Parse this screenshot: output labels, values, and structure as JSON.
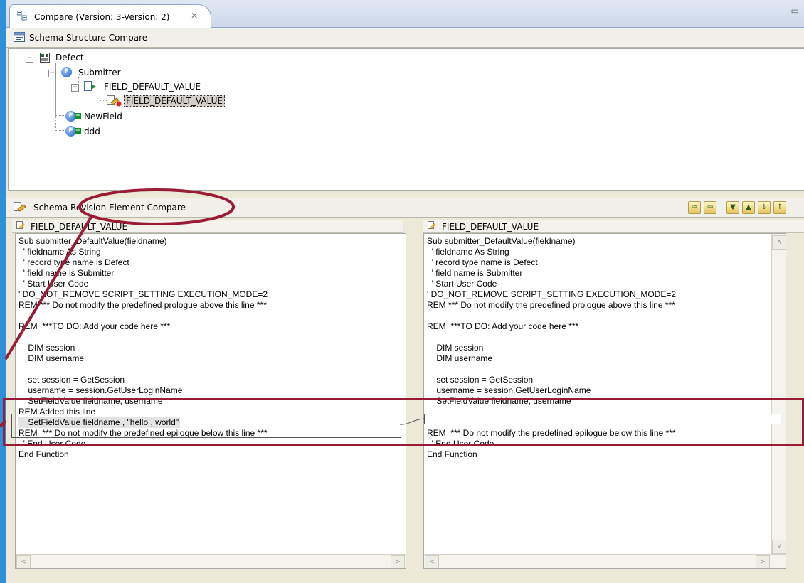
{
  "window": {
    "tab_title": "Compare (Version: 3-Version: 2)",
    "tab_close": "✕",
    "min_max": "▭"
  },
  "structure": {
    "header": "Schema Structure Compare",
    "nodes": {
      "defect": "Defect",
      "submitter": "Submitter",
      "field_default_value": "FIELD_DEFAULT_VALUE",
      "field_default_value_child": "FIELD_DEFAULT_VALUE",
      "newfield": "NewField",
      "ddd": "ddd"
    }
  },
  "revision": {
    "header": "Schema Revision Element Compare",
    "toolbar": [
      "copy-all-right",
      "copy-current-right",
      "next-diff",
      "prev-diff",
      "next-change",
      "prev-change"
    ]
  },
  "left_pane": {
    "title": "FIELD_DEFAULT_VALUE",
    "lines": [
      "Sub submitter_DefaultValue(fieldname)",
      "  ' fieldname As String",
      "  ' record type name is Defect",
      "  ' field name is Submitter",
      "  ' Start User Code",
      "' DO_NOT_REMOVE SCRIPT_SETTING EXECUTION_MODE=2",
      "REM *** Do not modify the predefined prologue above this line ***",
      "",
      "REM  ***TO DO: Add your code here ***",
      "",
      "    DIM session",
      "    DIM username",
      "",
      "    set session = GetSession",
      "    username = session.GetUserLoginName",
      "    SetFieldValue fieldname, username",
      "REM Added this line",
      "    SetFieldValue fieldname , \"hello , world\"",
      "REM  *** Do not modify the predefined epilogue below this line ***",
      "  ' End User Code",
      "End Function"
    ]
  },
  "right_pane": {
    "title": "FIELD_DEFAULT_VALUE",
    "lines": [
      "Sub submitter_DefaultValue(fieldname)",
      "  ' fieldname As String",
      "  ' record type name is Defect",
      "  ' field name is Submitter",
      "  ' Start User Code",
      "' DO_NOT_REMOVE SCRIPT_SETTING EXECUTION_MODE=2",
      "REM *** Do not modify the predefined prologue above this line ***",
      "",
      "REM  ***TO DO: Add your code here ***",
      "",
      "    DIM session",
      "    DIM username",
      "",
      "    set session = GetSession",
      "    username = session.GetUserLoginName",
      "    SetFieldValue fieldname, username",
      "",
      "REM  *** Do not modify the predefined epilogue below this line ***",
      "  ' End User Code",
      "End Function"
    ]
  },
  "colors": {
    "annotation": "#9a1b35",
    "desktop": "#2f8fd8"
  }
}
